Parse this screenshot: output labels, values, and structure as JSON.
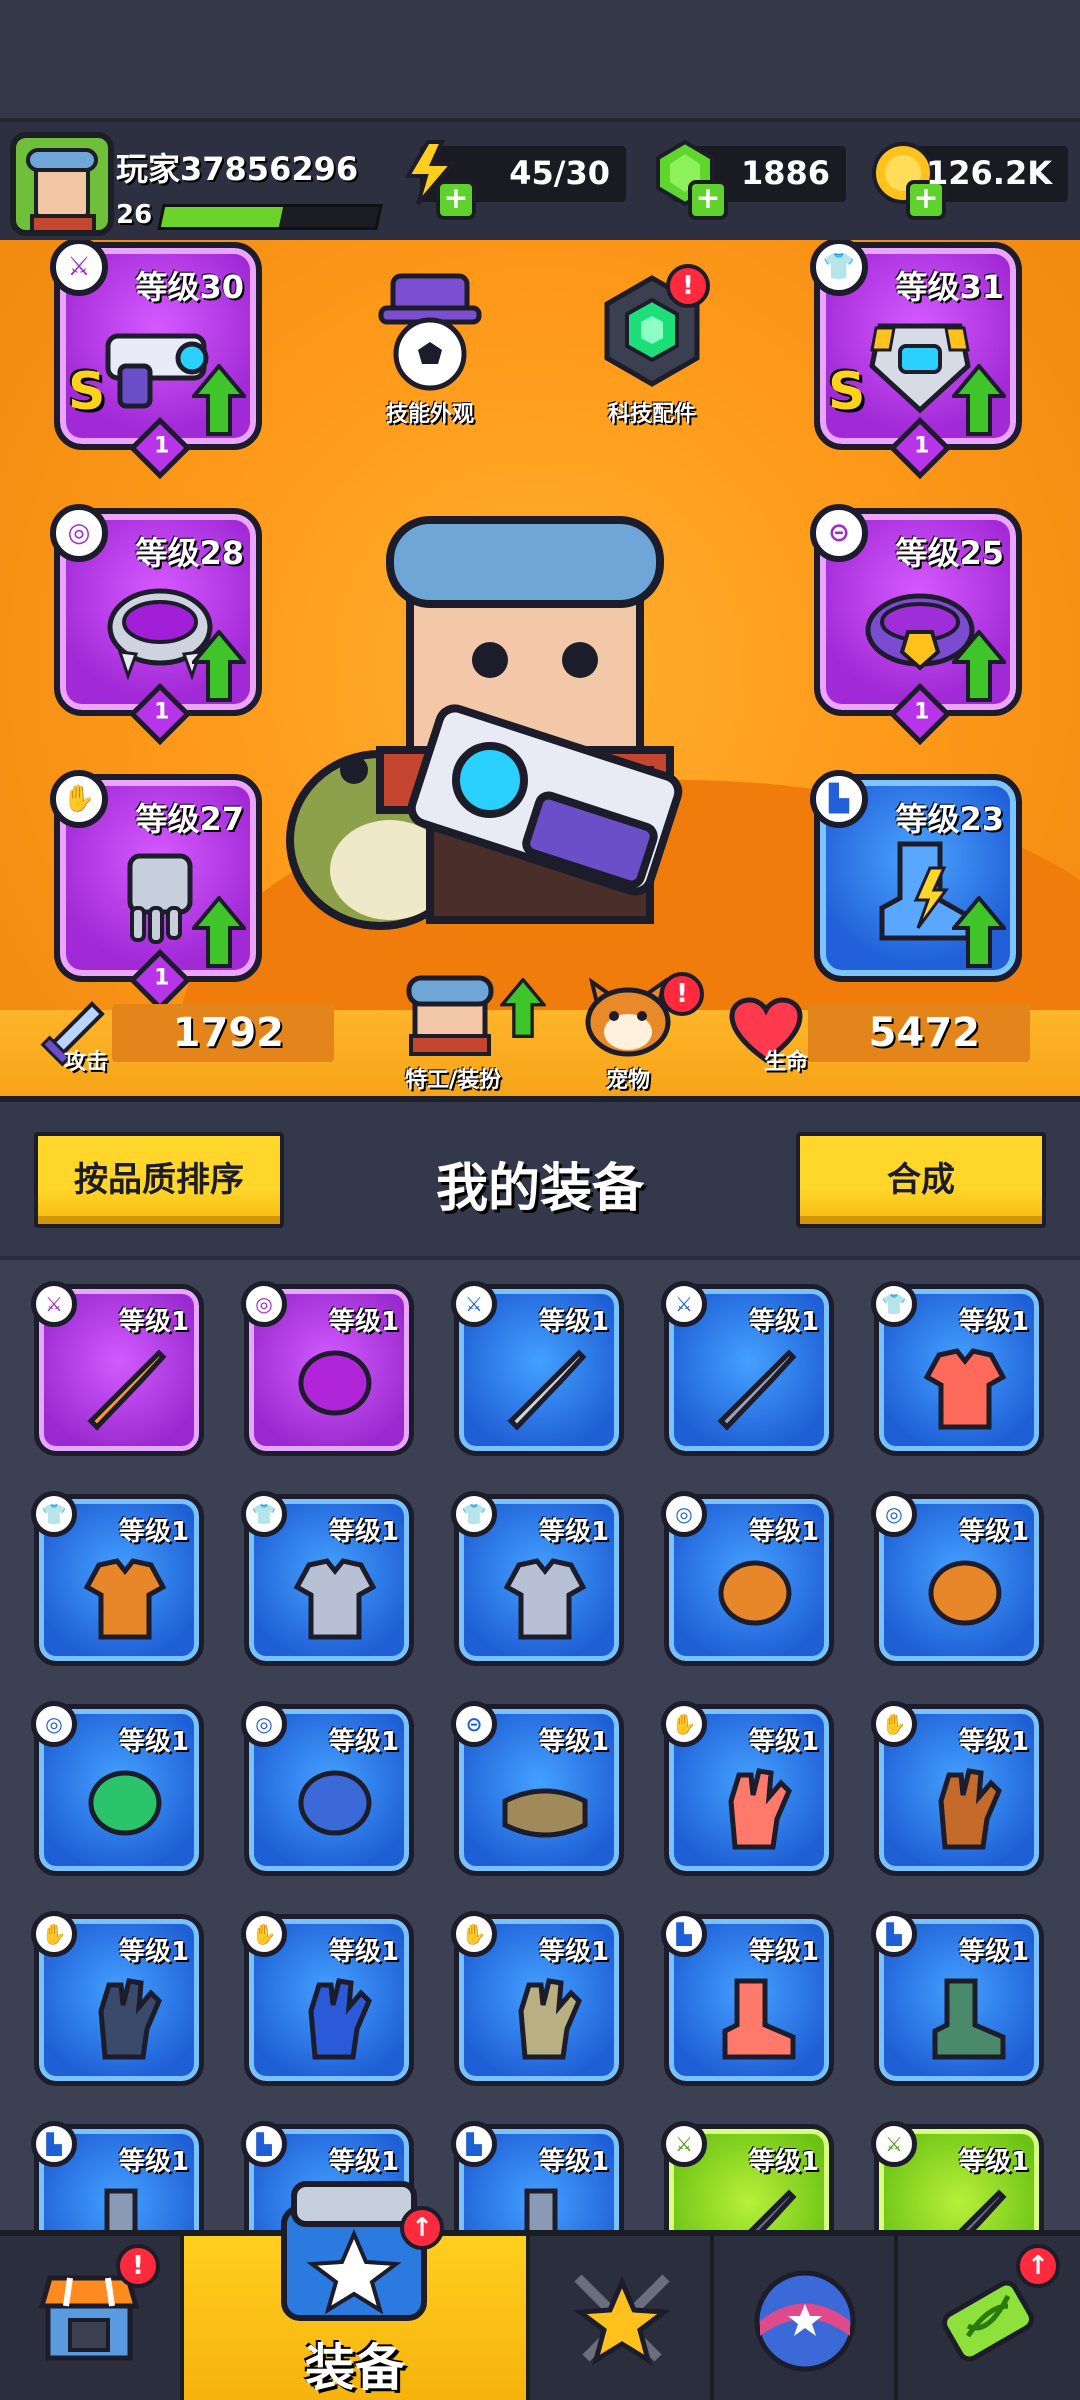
{
  "player": {
    "name": "玩家37856296",
    "level": "26",
    "xp_fraction": 0.55
  },
  "currencies": {
    "energy": "45/30",
    "gems": "1886",
    "coins": "126.2K"
  },
  "equipped": {
    "weapon": {
      "level": "等级30",
      "rank": "1",
      "grade": "S",
      "icon": "weapon-icon"
    },
    "armor": {
      "level": "等级31",
      "rank": "1",
      "grade": "S",
      "icon": "shirt-icon"
    },
    "necklace": {
      "level": "等级28",
      "rank": "1",
      "icon": "necklace-icon"
    },
    "belt": {
      "level": "等级25",
      "rank": "1",
      "icon": "belt-icon"
    },
    "gloves": {
      "level": "等级27",
      "rank": "1",
      "icon": "glove-icon"
    },
    "boots": {
      "level": "等级23",
      "icon": "boot-icon"
    }
  },
  "hero_menu": {
    "skin_label": "技能外观",
    "tech_label": "科技配件",
    "agent_label": "特工/装扮",
    "pet_label": "宠物",
    "attack_label": "攻击",
    "attack_value": "1792",
    "hp_label": "生命",
    "hp_value": "5472"
  },
  "inventory_header": {
    "sort_button": "按品质排序",
    "title": "我的装备",
    "merge_button": "合成"
  },
  "inventory": [
    {
      "level": "等级1",
      "rarity": "purple",
      "type": "weapon-icon",
      "art": "mic-staff"
    },
    {
      "level": "等级1",
      "rarity": "purple",
      "type": "necklace-icon",
      "art": "spike-collar"
    },
    {
      "level": "等级1",
      "rarity": "blue",
      "type": "weapon-icon",
      "art": "kunai"
    },
    {
      "level": "等级1",
      "rarity": "blue",
      "type": "weapon-icon",
      "art": "revolver"
    },
    {
      "level": "等级1",
      "rarity": "blue",
      "type": "shirt-icon",
      "art": "red-vest"
    },
    {
      "level": "等级1",
      "rarity": "blue",
      "type": "shirt-icon",
      "art": "orange-coat"
    },
    {
      "level": "等级1",
      "rarity": "blue",
      "type": "shirt-icon",
      "art": "steel-armor"
    },
    {
      "level": "等级1",
      "rarity": "blue",
      "type": "shirt-icon",
      "art": "steel-armor"
    },
    {
      "level": "等级1",
      "rarity": "blue",
      "type": "necklace-icon",
      "art": "bolt-necklace"
    },
    {
      "level": "等级1",
      "rarity": "blue",
      "type": "necklace-icon",
      "art": "bolt-necklace"
    },
    {
      "level": "等级1",
      "rarity": "blue",
      "type": "necklace-icon",
      "art": "gem-necklace"
    },
    {
      "level": "等级1",
      "rarity": "blue",
      "type": "necklace-icon",
      "art": "blue-collar"
    },
    {
      "level": "等级1",
      "rarity": "blue",
      "type": "belt-icon",
      "art": "leather-belt"
    },
    {
      "level": "等级1",
      "rarity": "blue",
      "type": "glove-icon",
      "art": "red-glove"
    },
    {
      "level": "等级1",
      "rarity": "blue",
      "type": "glove-icon",
      "art": "brown-glove"
    },
    {
      "level": "等级1",
      "rarity": "blue",
      "type": "glove-icon",
      "art": "dark-glove"
    },
    {
      "level": "等级1",
      "rarity": "blue",
      "type": "glove-icon",
      "art": "blue-glove"
    },
    {
      "level": "等级1",
      "rarity": "blue",
      "type": "glove-icon",
      "art": "khaki-glove"
    },
    {
      "level": "等级1",
      "rarity": "blue",
      "type": "boot-icon",
      "art": "claw-boot"
    },
    {
      "level": "等级1",
      "rarity": "blue",
      "type": "boot-icon",
      "art": "green-boot"
    },
    {
      "level": "等级1",
      "rarity": "blue",
      "type": "boot-icon",
      "art": "boot"
    },
    {
      "level": "等级1",
      "rarity": "blue",
      "type": "boot-icon",
      "art": "boot"
    },
    {
      "level": "等级1",
      "rarity": "blue",
      "type": "boot-icon",
      "art": "boot"
    },
    {
      "level": "等级1",
      "rarity": "green",
      "type": "weapon-icon",
      "art": "spear"
    },
    {
      "level": "等级1",
      "rarity": "green",
      "type": "weapon-icon",
      "art": "spear"
    }
  ],
  "bottom_nav": {
    "active_label": "装备"
  },
  "colors": {
    "accent_yellow": "#ffd629",
    "purple_rarity": "#a12ad6",
    "blue_rarity": "#2160d8",
    "green_rarity": "#6ac213",
    "hero_bg": "#ff9a1a"
  }
}
